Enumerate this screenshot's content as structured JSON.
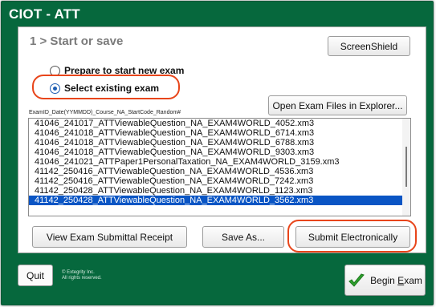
{
  "window": {
    "title": "CIOT - ATT"
  },
  "step": {
    "title": "1 > Start or save"
  },
  "buttons": {
    "screenshield": "ScreenShield",
    "open_files": "Open Exam Files in Explorer...",
    "view_receipt": "View Exam Submittal Receipt",
    "save_as": "Save As...",
    "submit": "Submit Electronically",
    "quit": "Quit",
    "begin_prefix": "Begin ",
    "begin_underlined": "E",
    "begin_suffix": "xam"
  },
  "options": {
    "prepare": {
      "label": "Prepare to start new exam",
      "checked": false
    },
    "select": {
      "label": "Select existing exam",
      "checked": true
    }
  },
  "list": {
    "caption": "ExamID_Date(YYMMDD)_Course_NA_StartCode_Random#",
    "items": [
      "41046_241017_ATTViewableQuestion_NA_EXAM4WORLD_4052.xm3",
      "41046_241018_ATTViewableQuestion_NA_EXAM4WORLD_6714.xm3",
      "41046_241018_ATTViewableQuestion_NA_EXAM4WORLD_6788.xm3",
      "41046_241018_ATTViewableQuestion_NA_EXAM4WORLD_9303.xm3",
      "41046_241021_ATTPaper1PersonalTaxation_NA_EXAM4WORLD_3159.xm3",
      "41142_250416_ATTViewableQuestion_NA_EXAM4WORLD_4536.xm3",
      "41142_250416_ATTViewableQuestion_NA_EXAM4WORLD_7242.xm3",
      "41142_250428_ATTViewableQuestion_NA_EXAM4WORLD_1123.xm3",
      "41142_250428_ATTViewableQuestion_NA_EXAM4WORLD_3562.xm3"
    ],
    "selected_index": 8
  },
  "footer": {
    "copyright_line1": "© Extegrity Inc.",
    "copyright_line2": "All rights reserved."
  },
  "colors": {
    "window_bg": "#06683d",
    "highlight": "#e8451a",
    "selection": "#0a55c4",
    "check_green": "#2ea12e"
  },
  "icons": {
    "begin": "checkmark-icon"
  }
}
